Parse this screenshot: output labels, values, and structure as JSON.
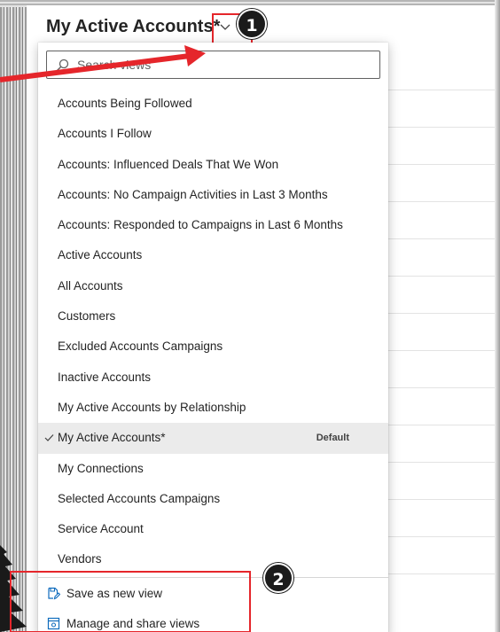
{
  "header": {
    "view_title": "My Active Accounts*"
  },
  "search": {
    "placeholder": "Search views"
  },
  "views": [
    {
      "label": "Accounts Being Followed"
    },
    {
      "label": "Accounts I Follow"
    },
    {
      "label": "Accounts: Influenced Deals That We Won"
    },
    {
      "label": "Accounts: No Campaign Activities in Last 3 Months"
    },
    {
      "label": "Accounts: Responded to Campaigns in Last 6 Months"
    },
    {
      "label": "Active Accounts"
    },
    {
      "label": "All Accounts"
    },
    {
      "label": "Customers"
    },
    {
      "label": "Excluded Accounts Campaigns"
    },
    {
      "label": "Inactive Accounts"
    },
    {
      "label": "My Active Accounts by Relationship"
    },
    {
      "label": "My Active Accounts*",
      "selected": true,
      "badge": "Default"
    },
    {
      "label": "My Connections"
    },
    {
      "label": "Selected Accounts Campaigns"
    },
    {
      "label": "Service Account"
    },
    {
      "label": "Vendors"
    }
  ],
  "actions": {
    "save_label": "Save as new view",
    "manage_label": "Manage and share views"
  },
  "annotations": {
    "callout_1": "1",
    "callout_2": "2"
  },
  "colors": {
    "highlight": "#e5262b",
    "selected_row": "#ebebeb",
    "action_icon": "#0f6cbd"
  },
  "icons": {
    "search": "search-icon",
    "chevron": "chevron-down-icon",
    "check": "checkmark-icon",
    "save": "save-as-icon",
    "manage": "manage-views-icon"
  }
}
